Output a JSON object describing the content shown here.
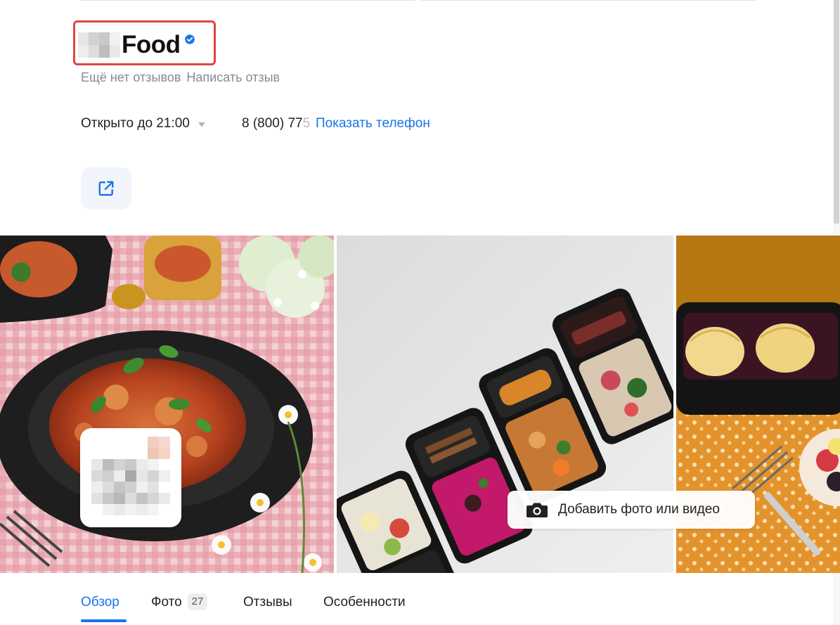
{
  "header": {
    "title_suffix": "Food",
    "verified": true
  },
  "reviews": {
    "none_text": "Ещё нет отзывов",
    "write_link": "Написать отзыв"
  },
  "contacts": {
    "hours": "Открыто до 21:00",
    "phone_visible": "8 (800) 77",
    "phone_faded": "5",
    "show_phone": "Показать телефон"
  },
  "gallery": {
    "add_photo": "Добавить фото или видео",
    "photos": [
      {
        "subject": "pasta-dish"
      },
      {
        "subject": "meal-boxes"
      },
      {
        "subject": "dessert-box"
      }
    ]
  },
  "tabs": [
    {
      "label": "Обзор",
      "active": true
    },
    {
      "label": "Фото",
      "badge": "27"
    },
    {
      "label": "Отзывы"
    },
    {
      "label": "Особенности"
    }
  ],
  "colors": {
    "accent": "#1a73e8",
    "highlight_box": "#e04444",
    "muted_text": "#8a8a8a"
  }
}
